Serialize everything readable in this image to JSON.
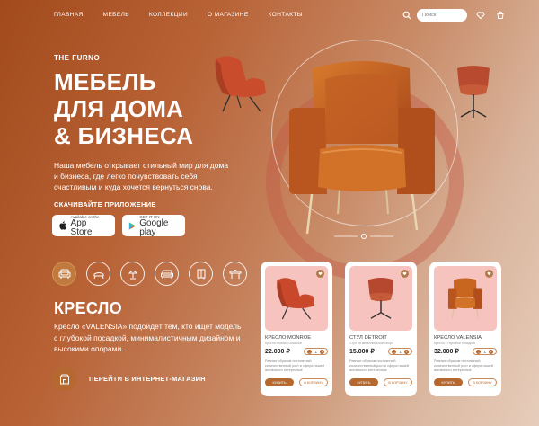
{
  "nav": {
    "items": [
      "ГЛАВНАЯ",
      "МЕБЕЛЬ",
      "КОЛЛЕКЦИИ",
      "О МАГАЗИНЕ",
      "КОНТАКТЫ"
    ],
    "search_placeholder": "Поиск"
  },
  "hero": {
    "brand": "THE FURNO",
    "title_lines": [
      "МЕБЕЛЬ",
      "ДЛЯ ДОМА",
      "& БИЗНЕСА"
    ],
    "description": "Наша мебель открывает стильный мир для дома и бизнеса, где легко почувствовать себя счастливым и куда хочется вернуться снова.",
    "apps_title": "СКАЧИВАЙТЕ ПРИЛОЖЕНИЕ",
    "appstore_small": "Available on the",
    "appstore_big": "App Store",
    "googleplay_small": "GET IT ON",
    "googleplay_big": "Google play"
  },
  "section": {
    "title": "КРЕСЛО",
    "description": "Кресло «VALENSIA» подойдёт тем, кто ищет модель с глубокой посадкой, минималистичным дизайном и высокими опорами.",
    "shop_link": "ПЕРЕЙТИ В ИНТЕРНЕТ-МАГАЗИН"
  },
  "categories": [
    "armchair-icon",
    "chair-icon",
    "lamp-icon",
    "sofa-icon",
    "wardrobe-icon",
    "table-icon"
  ],
  "products": [
    {
      "name": "КРЕСЛО MONROE",
      "subtitle": "Кресло с мягкой обивкой",
      "price": "22.000 ₽",
      "qty": "1",
      "description": "Равные образом постоянный количественный рост и сфера нашей активности интересные",
      "buy": "КУПИТЬ",
      "cart": "В КОРЗИНУ"
    },
    {
      "name": "СТУЛ DETROIT",
      "subtitle": "Стул на металлической опоре",
      "price": "15.000 ₽",
      "qty": "1",
      "description": "Равные образом постоянный количественный рост и сфера нашей активности интересные",
      "buy": "КУПИТЬ",
      "cart": "В КОРЗИНУ"
    },
    {
      "name": "КРЕСЛО VALENSIA",
      "subtitle": "Кресло с глубокой посадкой",
      "price": "32.000 ₽",
      "qty": "1",
      "description": "Равные образом постоянный количественный рост и сфера нашей активности интересные",
      "buy": "КУПИТЬ",
      "cart": "В КОРЗИНУ"
    }
  ],
  "colors": {
    "accent": "#b5682f",
    "card_image_bg": "#f6c3be",
    "chair_orange": "#c8651f"
  }
}
